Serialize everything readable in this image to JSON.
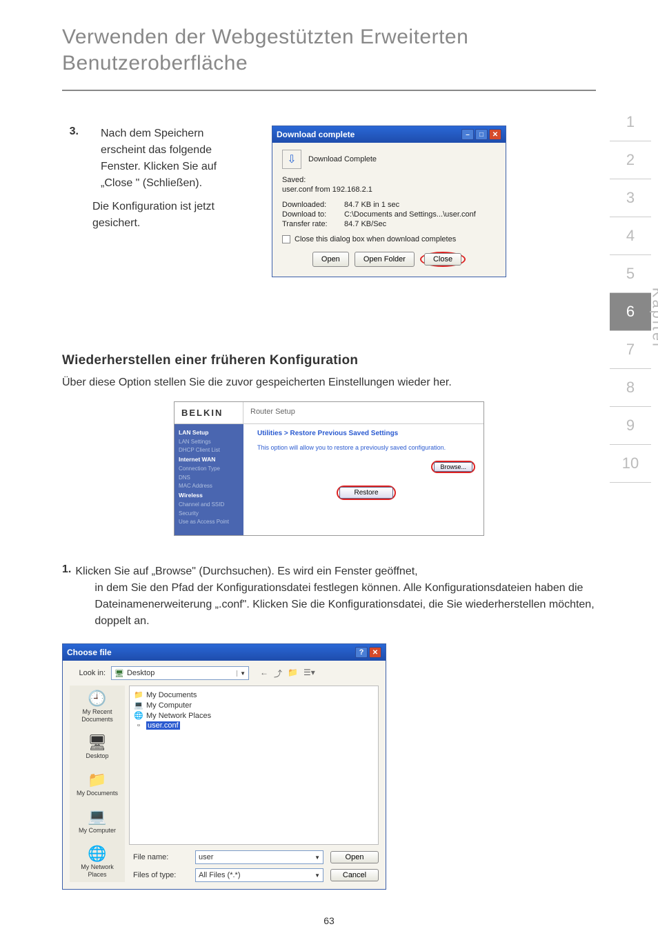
{
  "header": {
    "title": "Verwenden der Webgestützten Erweiterten Benutzeroberfläche"
  },
  "step3": {
    "number": "3.",
    "p1": "Nach dem Speichern erscheint das folgende Fenster. Klicken Sie auf „Close \" (Schließen).",
    "p2": "Die Konfiguration ist jetzt gesichert."
  },
  "download_dialog": {
    "title": "Download complete",
    "heading": "Download Complete",
    "saved_label": "Saved:",
    "saved_value": "user.conf from 192.168.2.1",
    "rows": {
      "downloaded_label": "Downloaded:",
      "downloaded_value": "84.7 KB in 1 sec",
      "to_label": "Download to:",
      "to_value": "C:\\Documents and Settings...\\user.conf",
      "rate_label": "Transfer rate:",
      "rate_value": "84.7 KB/Sec"
    },
    "checkbox_label": "Close this dialog box when download completes",
    "buttons": {
      "open": "Open",
      "open_folder": "Open Folder",
      "close": "Close"
    }
  },
  "section2": {
    "title": "Wiederherstellen einer früheren Konfiguration",
    "desc": "Über diese Option stellen Sie die zuvor gespeicherten Einstellungen wieder her."
  },
  "router": {
    "brand": "BELKIN",
    "crumb": "Router Setup",
    "sidebar": {
      "lan_setup": "LAN Setup",
      "lan_settings": "LAN Settings",
      "dhcp": "DHCP Client List",
      "internet_wan": "Internet WAN",
      "conn_type": "Connection Type",
      "dns": "DNS",
      "mac": "MAC Address",
      "wireless": "Wireless",
      "channel": "Channel and SSID",
      "security": "Security",
      "ap": "Use as Access Point"
    },
    "main": {
      "title": "Utilities > Restore Previous Saved Settings",
      "desc": "This option will allow you to restore a previously saved configuration.",
      "browse": "Browse...",
      "restore": "Restore"
    }
  },
  "step1": {
    "number": "1.",
    "line1": "Klicken Sie auf „Browse\" (Durchsuchen). Es wird ein Fenster geöffnet,",
    "line2": "in dem Sie den Pfad der Konfigurationsdatei festlegen können. Alle Konfigurationsdateien haben die Dateinamenerweiterung „.conf\". Klicken Sie die Konfigurationsdatei, die Sie wiederherstellen möchten, doppelt an."
  },
  "choose": {
    "title": "Choose file",
    "look_in_label": "Look in:",
    "look_in_value": "Desktop",
    "items": {
      "my_documents": "My Documents",
      "my_computer": "My Computer",
      "my_network_places": "My Network Places",
      "user_conf": "user.conf"
    },
    "places": {
      "recent": "My Recent Documents",
      "desktop": "Desktop",
      "documents": "My Documents",
      "computer": "My Computer",
      "network": "My Network Places"
    },
    "filename_label": "File name:",
    "filename_value": "user",
    "filetype_label": "Files of type:",
    "filetype_value": "All Files (*.*)",
    "open": "Open",
    "cancel": "Cancel"
  },
  "nav": {
    "items": [
      "1",
      "2",
      "3",
      "4",
      "5",
      "6",
      "7",
      "8",
      "9",
      "10"
    ],
    "active_index": 5,
    "label": "Kapitel"
  },
  "page_number": "63"
}
